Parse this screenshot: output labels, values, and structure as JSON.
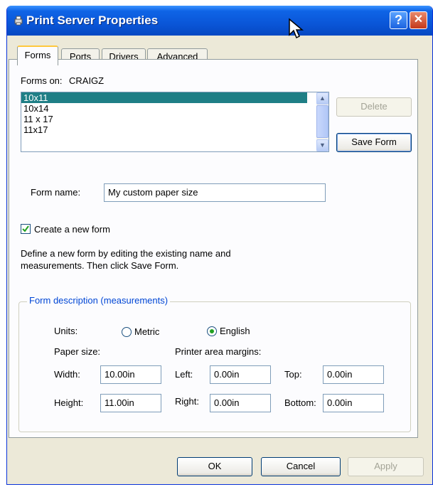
{
  "window": {
    "title": "Print Server Properties",
    "help_glyph": "?",
    "close_glyph": "✕"
  },
  "tabs": [
    {
      "label": "Forms",
      "active": true
    },
    {
      "label": "Ports",
      "active": false
    },
    {
      "label": "Drivers",
      "active": false
    },
    {
      "label": "Advanced",
      "active": false
    }
  ],
  "forms": {
    "forms_on_label": "Forms on:",
    "server_name": "CRAIGZ",
    "list": [
      "10x11",
      "10x14",
      "11 x 17",
      "11x17"
    ],
    "selected_index": 0,
    "delete_label": "Delete",
    "save_form_label": "Save Form",
    "form_name_label": "Form name:",
    "form_name_value": "My custom paper size",
    "create_new_label": "Create a new form",
    "create_new_checked": true,
    "description_line1": "Define a new form by editing the existing name and",
    "description_line2": "measurements.  Then click Save Form."
  },
  "measurements": {
    "group_title": "Form description (measurements)",
    "units_label": "Units:",
    "metric_label": "Metric",
    "english_label": "English",
    "selected_unit": "English",
    "paper_size_label": "Paper size:",
    "margins_label": "Printer area margins:",
    "width_label": "Width:",
    "width_value": "10.00in",
    "height_label": "Height:",
    "height_value": "11.00in",
    "left_label": "Left:",
    "left_value": "0.00in",
    "right_label": "Right:",
    "right_value": "0.00in",
    "top_label": "Top:",
    "top_value": "0.00in",
    "bottom_label": "Bottom:",
    "bottom_value": "0.00in"
  },
  "footer": {
    "ok_label": "OK",
    "cancel_label": "Cancel",
    "apply_label": "Apply"
  },
  "colors": {
    "title_bar": "#0a56d8",
    "selection": "#1f7f86",
    "group_title": "#0046d5"
  }
}
